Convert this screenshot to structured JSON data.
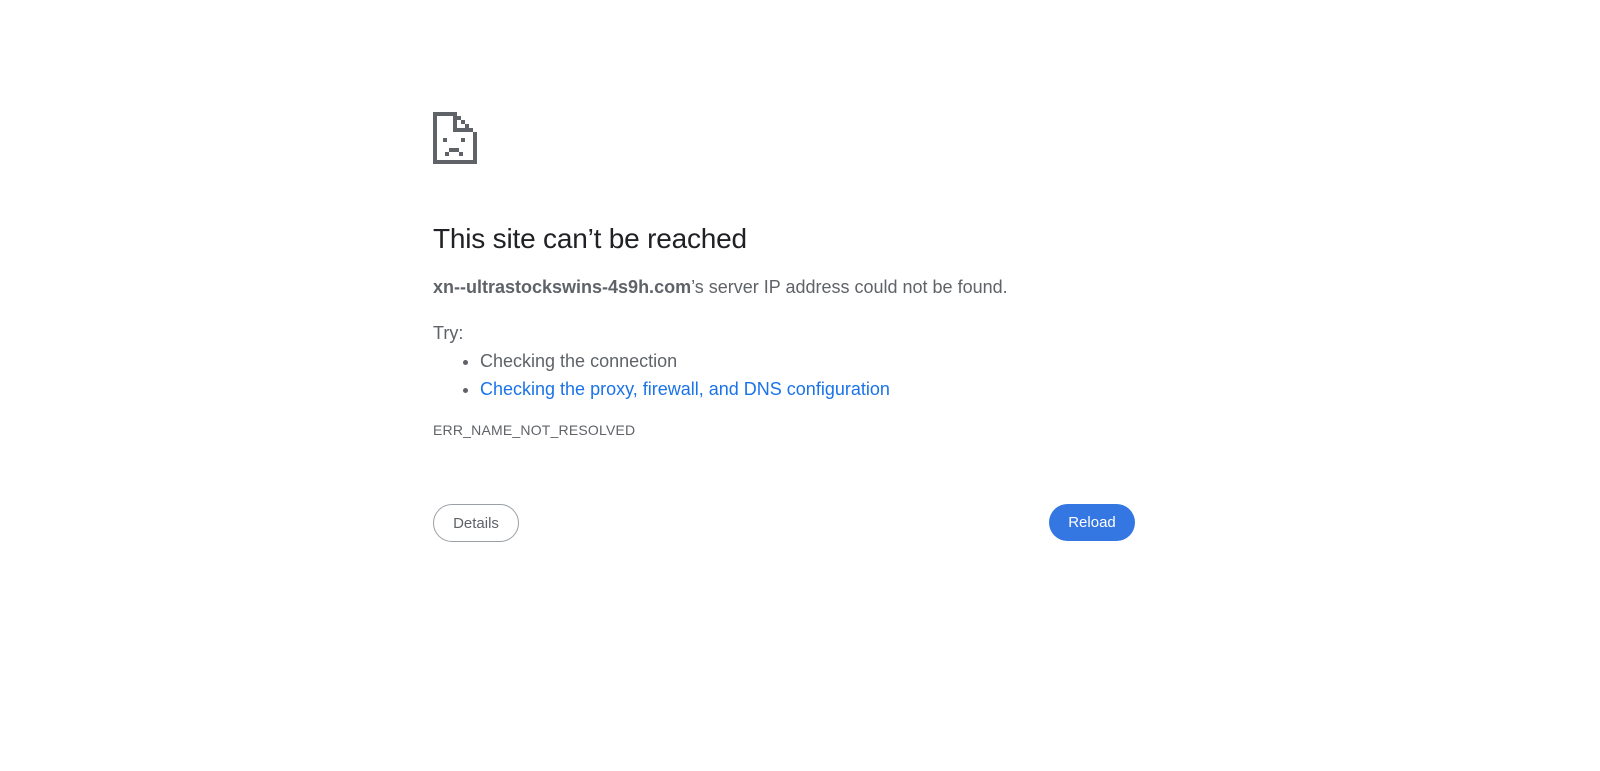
{
  "error_page": {
    "icon": "sad-page-icon",
    "title": "This site can’t be reached",
    "host": "xn--ultrastockswins-4s9h.com",
    "summary_suffix": "’s server IP address could not be found.",
    "try_label": "Try:",
    "suggestions": [
      {
        "label": "Checking the connection",
        "is_link": false
      },
      {
        "label": "Checking the proxy, firewall, and DNS configuration",
        "is_link": true
      }
    ],
    "error_code": "ERR_NAME_NOT_RESOLVED",
    "details_button_label": "Details",
    "reload_button_label": "Reload"
  },
  "colors": {
    "title_text": "#202124",
    "body_text": "#5f6368",
    "link": "#1a73e8",
    "reload_button_bg": "#3476e2",
    "details_button_border": "#9aa0a6",
    "icon": "#5f6368"
  }
}
